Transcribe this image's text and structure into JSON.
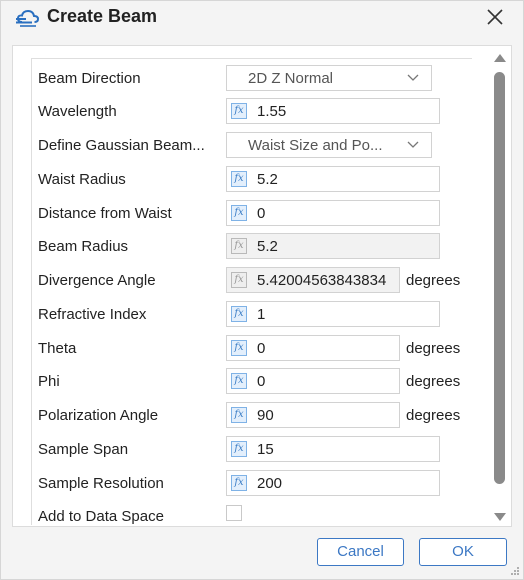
{
  "dialog": {
    "title": "Create Beam",
    "icon": "beam-cloud-icon",
    "close_icon": "close-icon"
  },
  "form": {
    "rows": [
      {
        "label": "Beam Direction",
        "type": "select",
        "value": "2D Z Normal"
      },
      {
        "label": "Wavelength",
        "type": "fx",
        "value": "1.55",
        "unit": "",
        "disabled": false
      },
      {
        "label": "Define Gaussian Beam...",
        "type": "select",
        "value": "Waist Size and Po..."
      },
      {
        "label": "Waist Radius",
        "type": "fx",
        "value": "5.2",
        "unit": "",
        "disabled": false
      },
      {
        "label": "Distance from Waist",
        "type": "fx",
        "value": "0",
        "unit": "",
        "disabled": false
      },
      {
        "label": "Beam Radius",
        "type": "fx",
        "value": "5.2",
        "unit": "",
        "disabled": true
      },
      {
        "label": "Divergence Angle",
        "type": "fx",
        "value": "5.42004563843834",
        "unit": "degrees",
        "disabled": true
      },
      {
        "label": "Refractive Index",
        "type": "fx",
        "value": "1",
        "unit": "",
        "disabled": false
      },
      {
        "label": "Theta",
        "type": "fx",
        "value": "0",
        "unit": "degrees",
        "disabled": false
      },
      {
        "label": "Phi",
        "type": "fx",
        "value": "0",
        "unit": "degrees",
        "disabled": false
      },
      {
        "label": "Polarization Angle",
        "type": "fx",
        "value": "90",
        "unit": "degrees",
        "disabled": false
      },
      {
        "label": "Sample Span",
        "type": "fx",
        "value": "15",
        "unit": "",
        "disabled": false
      },
      {
        "label": "Sample Resolution",
        "type": "fx",
        "value": "200",
        "unit": "",
        "disabled": false
      },
      {
        "label": "Add to Data Space",
        "type": "checkbox",
        "checked": false
      }
    ],
    "fx_glyph": "fx"
  },
  "buttons": {
    "cancel": "Cancel",
    "ok": "OK"
  },
  "colors": {
    "accent": "#3c78c4",
    "fx_icon": "#7fb2e6",
    "scroll_thumb": "#8a8a8a"
  }
}
